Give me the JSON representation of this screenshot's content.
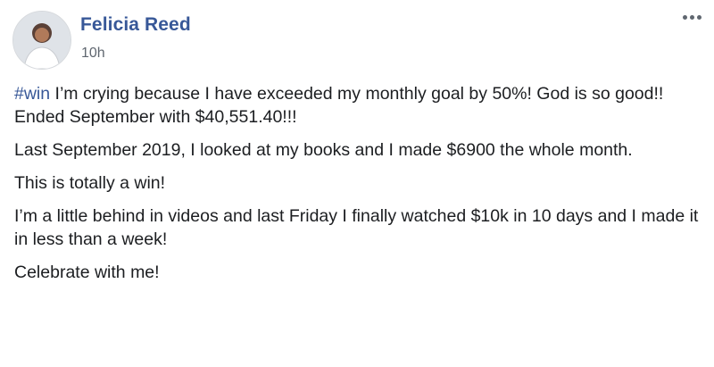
{
  "post": {
    "author": "Felicia Reed",
    "timestamp": "10h",
    "avatar_icon": "user-avatar-photo",
    "more_icon": "ellipsis-horizontal-icon",
    "hashtag": "#win",
    "paragraphs": [
      " I’m crying because I have exceeded my monthly goal by 50%! God is so good!!",
      "Ended September with $40,551.40!!!",
      "Last September 2019, I looked at my books and I made $6900 the whole month.",
      "This is totally a win!",
      "I’m a little behind in videos and last Friday I finally watched $10k in 10 days and I made it in less than a week!",
      "Celebrate with me!"
    ]
  },
  "colors": {
    "link": "#385898",
    "text": "#1c1e21",
    "meta": "#606770"
  }
}
